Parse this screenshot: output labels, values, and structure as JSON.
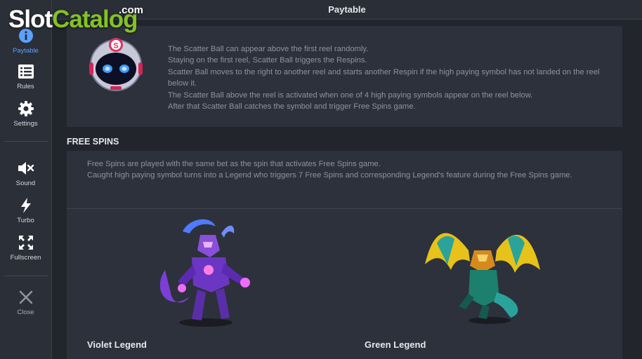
{
  "watermark": {
    "slot": "Slot",
    "catalog": "Catalog",
    "com": ".com"
  },
  "header": {
    "title": "Paytable"
  },
  "sidebar": {
    "items": [
      {
        "label": "Paytable",
        "icon": "info-icon"
      },
      {
        "label": "Rules",
        "icon": "list-icon"
      },
      {
        "label": "Settings",
        "icon": "gear-icon"
      },
      {
        "label": "Sound",
        "icon": "sound-muted-icon"
      },
      {
        "label": "Turbo",
        "icon": "lightning-icon"
      },
      {
        "label": "Fullscreen",
        "icon": "fullscreen-icon"
      },
      {
        "label": "Close",
        "icon": "close-icon"
      }
    ]
  },
  "scatter": {
    "lines": [
      "The Scatter Ball can appear above the first reel randomly.",
      "Staying on the first reel, Scatter Ball triggers the Respins.",
      "Scatter Ball moves to the right to another reel and starts another Respin if the high paying symbol has not landed on the reel below it.",
      "The Scatter Ball above the reel is activated when one of 4 high paying symbols appear on the reel below.",
      "After that Scatter Ball catches the symbol and trigger Free Spins game."
    ]
  },
  "free_spins": {
    "title": "FREE SPINS",
    "lines": [
      "Free Spins are played with the same bet as the spin that activates Free Spins game.",
      "Caught high paying symbol turns into a Legend who triggers 7 Free Spins and corresponding Legend's feature during the Free Spins game."
    ],
    "legends": [
      {
        "name": "Violet Legend"
      },
      {
        "name": "Green Legend"
      }
    ]
  },
  "colors": {
    "accent": "#5aa2ff",
    "brand_green": "#84c225",
    "background": "#22252c",
    "panel": "#2d313b"
  }
}
